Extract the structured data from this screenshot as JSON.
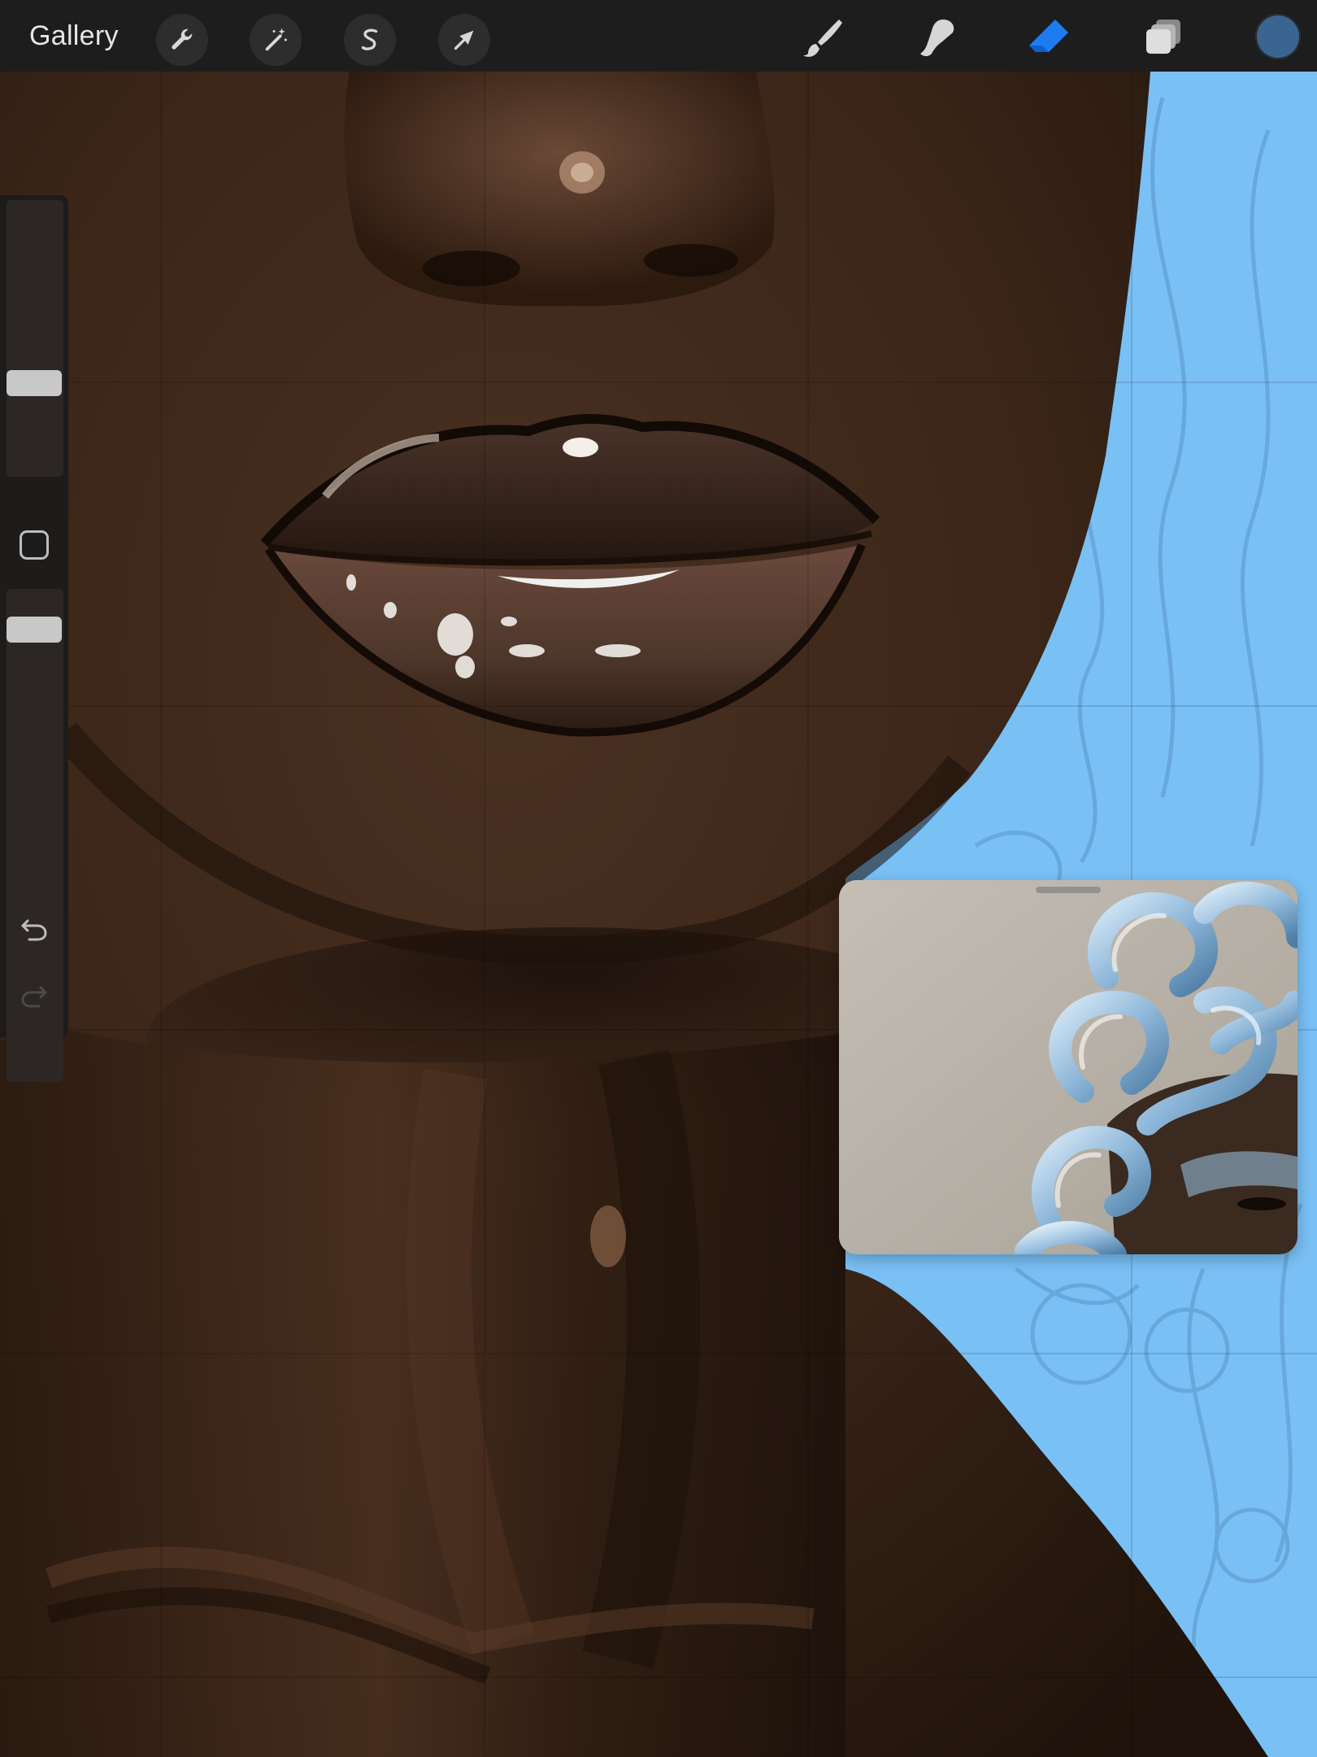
{
  "toolbar": {
    "gallery_label": "Gallery",
    "left_tools": [
      {
        "name": "actions",
        "icon": "wrench-icon"
      },
      {
        "name": "adjustments",
        "icon": "magic-wand-icon"
      },
      {
        "name": "selection",
        "icon": "selection-s-icon"
      },
      {
        "name": "transform",
        "icon": "arrow-cursor-icon"
      }
    ],
    "right_tools": [
      {
        "name": "brush",
        "icon": "brush-icon",
        "active": false
      },
      {
        "name": "smudge",
        "icon": "smudge-icon",
        "active": false
      },
      {
        "name": "eraser",
        "icon": "eraser-icon",
        "active": true
      },
      {
        "name": "layers",
        "icon": "layers-icon",
        "active": false
      }
    ],
    "current_color": "#3a6590",
    "active_tool_color": "#1d7cf2"
  },
  "sidebar": {
    "brush_size_level": 0.32,
    "opacity_level": 0.94,
    "undo_icon": "undo-icon",
    "redo_icon": "redo-icon",
    "redo_enabled": false
  },
  "canvas": {
    "background_color": "#79c0f5",
    "skin_color": "#3a2518"
  },
  "reference_window": {
    "visible": true
  }
}
